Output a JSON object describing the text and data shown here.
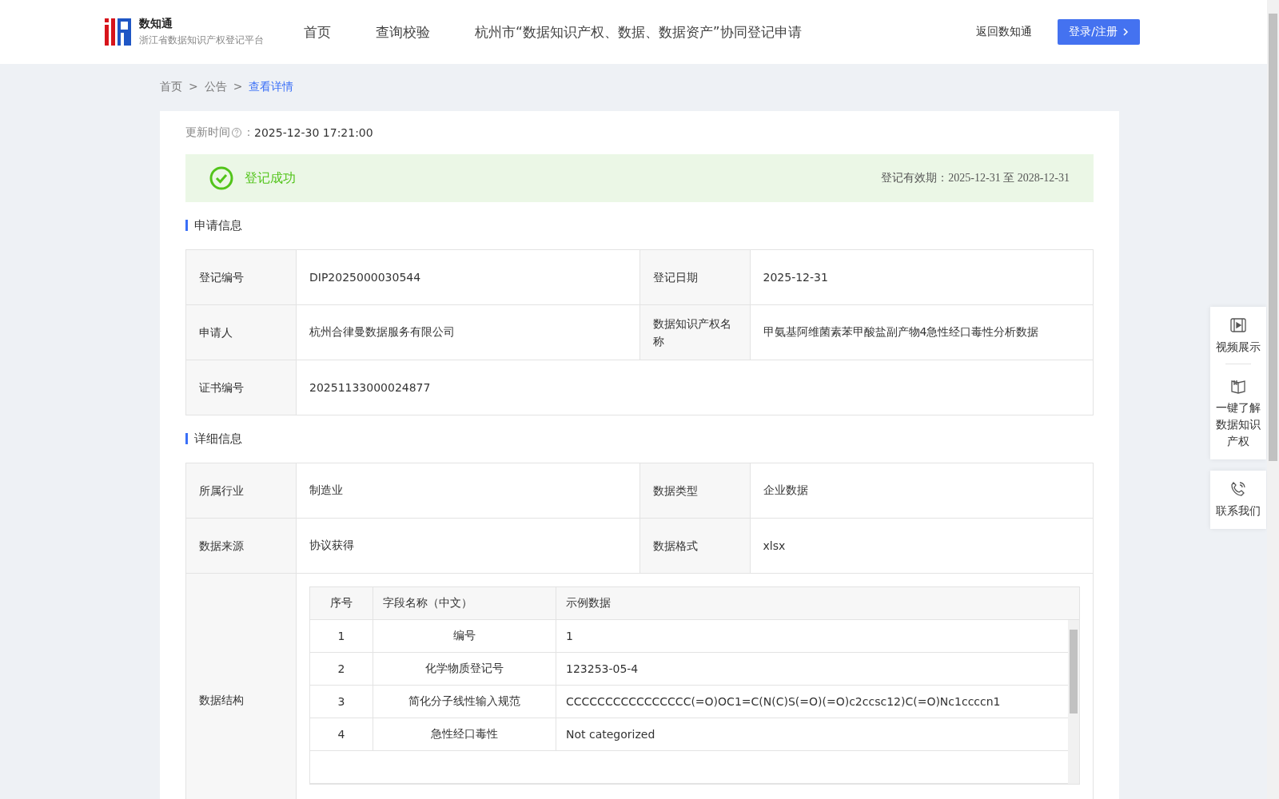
{
  "header": {
    "logo_title": "数知通",
    "logo_subtitle": "浙江省数据知识产权登记平台",
    "nav": [
      {
        "label": "首页",
        "selected": false
      },
      {
        "label": "查询校验",
        "selected": false
      },
      {
        "label": "杭州市“数据知识产权、数据、数据资产”协同登记申请",
        "selected": false
      }
    ],
    "back_link": "返回数知通",
    "login_button": "登录/注册"
  },
  "breadcrumb": [
    {
      "label": "首页",
      "selected": false
    },
    {
      "label": "公告",
      "selected": false
    },
    {
      "label": "查看详情",
      "selected": true
    }
  ],
  "breadcrumb_separator": ">",
  "update": {
    "label": "更新时间",
    "colon": "：",
    "value": "2025-12-30 17:21:00"
  },
  "status": {
    "text": "登记成功",
    "validity_label": "登记有效期：",
    "validity_from": "2025-12-31",
    "validity_to_word": "至",
    "validity_to": "2028-12-31"
  },
  "application_section": {
    "title": "申请信息",
    "rows": [
      {
        "cells": [
          {
            "label": "登记编号",
            "value": "DIP2025000030544"
          },
          {
            "label": "登记日期",
            "value": "2025-12-31"
          }
        ]
      },
      {
        "cells": [
          {
            "label": "申请人",
            "value": "杭州合律曼数据服务有限公司"
          },
          {
            "label": "数据知识产权名称",
            "value": "甲氨基阿维菌素苯甲酸盐副产物4急性经口毒性分析数据"
          }
        ]
      },
      {
        "cells": [
          {
            "label": "证书编号",
            "value": "20251133000024877"
          }
        ]
      }
    ]
  },
  "detail_section": {
    "title": "详细信息",
    "rows": [
      {
        "cells": [
          {
            "label": "所属行业",
            "value": "制造业"
          },
          {
            "label": "数据类型",
            "value": "企业数据"
          }
        ]
      },
      {
        "cells": [
          {
            "label": "数据来源",
            "value": "协议获得"
          },
          {
            "label": "数据格式",
            "value": "xlsx"
          }
        ]
      }
    ],
    "structure": {
      "label": "数据结构",
      "columns": [
        "序号",
        "字段名称（中文）",
        "示例数据"
      ],
      "rows": [
        [
          "1",
          "编号",
          "1"
        ],
        [
          "2",
          "化学物质登记号",
          "123253-05-4"
        ],
        [
          "3",
          "简化分子线性输入规范",
          "CCCCCCCCCCCCCCCC(=O)OC1=C(N(C)S(=O)(=O)c2ccsc12)C(=O)Nc1ccccn1"
        ],
        [
          "4",
          "急性经口毒性",
          "Not categorized"
        ]
      ]
    }
  },
  "side_panel": [
    {
      "kind": "video",
      "label": "视频展示"
    },
    {
      "kind": "book",
      "label": "一键了解数据知识产权"
    },
    {
      "kind": "phone",
      "label": "联系我们"
    }
  ]
}
